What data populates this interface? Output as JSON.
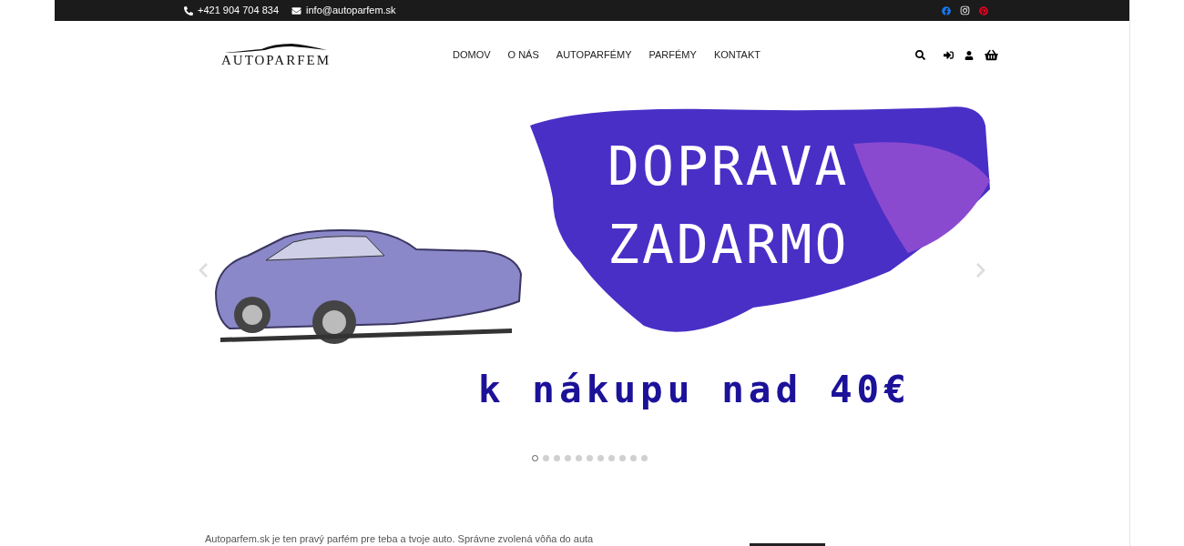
{
  "top_bar": {
    "phone": "+421 904 704 834",
    "email": "info@autoparfem.sk"
  },
  "header": {
    "logo": "AUTOPARFEM",
    "nav": [
      {
        "label": "DOMOV"
      },
      {
        "label": "O NÁS"
      },
      {
        "label": "AUTOPARFÉMY"
      },
      {
        "label": "PARFÉMY"
      },
      {
        "label": "KONTAKT"
      }
    ]
  },
  "slider": {
    "headline_lines": [
      "DOPRAVA",
      "ZADARMO"
    ],
    "subline": "k nákupu nad 40€",
    "dots": [
      {
        "selected": true
      },
      {
        "selected": false
      },
      {
        "selected": false
      },
      {
        "selected": false
      },
      {
        "selected": false
      },
      {
        "selected": false
      },
      {
        "selected": false
      },
      {
        "selected": false
      },
      {
        "selected": false
      },
      {
        "selected": false
      },
      {
        "selected": false
      }
    ]
  },
  "intro": {
    "text": "Autoparfem.sk je ten pravý parfém pre teba a tvoje auto. Správne zvolená vôňa do auta"
  }
}
